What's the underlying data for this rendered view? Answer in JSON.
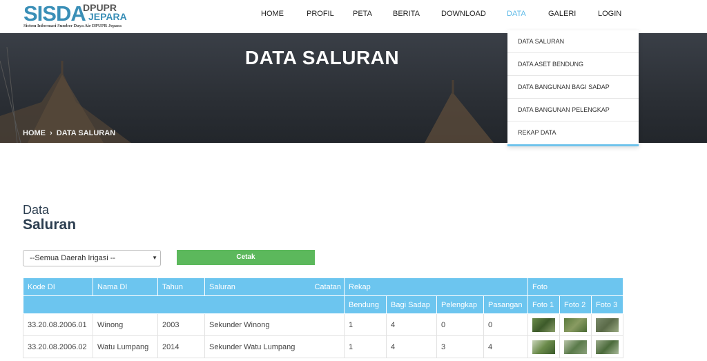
{
  "logo": {
    "main": "SISDA",
    "side_top": "DPUPR",
    "side_bottom": "JEPARA",
    "tagline": "Sistem Informasi Sumber Daya Air DPUPR Jepara"
  },
  "nav": {
    "items": [
      {
        "label": "HOME"
      },
      {
        "label": "PROFIL"
      },
      {
        "label": "PETA"
      },
      {
        "label": "BERITA"
      },
      {
        "label": "DOWNLOAD"
      },
      {
        "label": "DATA"
      },
      {
        "label": "GALERI"
      },
      {
        "label": "LOGIN"
      }
    ],
    "active": "DATA"
  },
  "dropdown": {
    "items": [
      "DATA SALURAN",
      "DATA ASET BENDUNG",
      "DATA BANGUNAN BAGI SADAP",
      "DATA BANGUNAN PELENGKAP",
      "REKAP DATA"
    ]
  },
  "banner": {
    "title": "DATA SALURAN",
    "breadcrumb_home": "HOME",
    "breadcrumb_sep": "›",
    "breadcrumb_current": "DATA SALURAN"
  },
  "section": {
    "title_small": "Data",
    "title_big": "Saluran"
  },
  "filter": {
    "select_value": "--Semua Daerah Irigasi --",
    "button": "Cetak"
  },
  "table": {
    "headers": {
      "kode": "Kode DI",
      "nama": "Nama DI",
      "tahun": "Tahun",
      "saluran": "Saluran",
      "catatan": "Catatan",
      "rekap": "Rekap",
      "foto": "Foto",
      "bendung": "Bendung",
      "bagi_sadap": "Bagi Sadap",
      "pelengkap": "Pelengkap",
      "pasangan": "Pasangan",
      "foto1": "Foto 1",
      "foto2": "Foto 2",
      "foto3": "Foto 3"
    },
    "rows": [
      {
        "kode": "33.20.08.2006.01",
        "nama": "Winong",
        "tahun": "2003",
        "saluran": "Sekunder Winong",
        "bendung": "1",
        "bagi_sadap": "4",
        "pelengkap": "0",
        "pasangan": "0"
      },
      {
        "kode": "33.20.08.2006.02",
        "nama": "Watu Lumpang",
        "tahun": "2014",
        "saluran": "Sekunder Watu Lumpang",
        "bendung": "1",
        "bagi_sadap": "4",
        "pelengkap": "3",
        "pasangan": "4"
      }
    ]
  }
}
